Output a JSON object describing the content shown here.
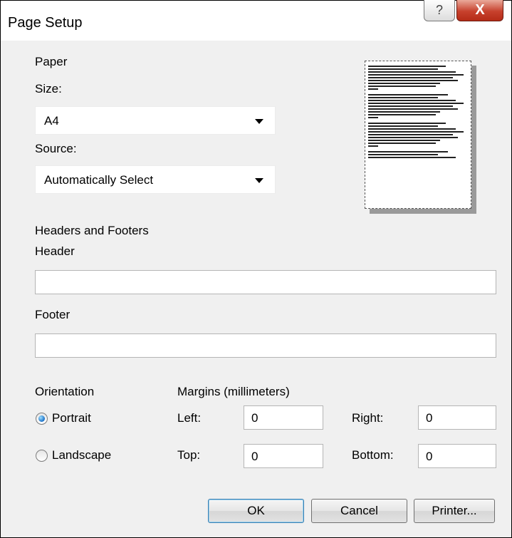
{
  "window": {
    "title": "Page Setup"
  },
  "titlebar": {
    "help_glyph": "?",
    "close_glyph": "X"
  },
  "paper": {
    "heading": "Paper",
    "size_label": "Size:",
    "size_value": "A4",
    "source_label": "Source:",
    "source_value": "Automatically Select"
  },
  "headers_footers": {
    "heading": "Headers and Footers",
    "header_label": "Header",
    "header_value": "",
    "footer_label": "Footer",
    "footer_value": ""
  },
  "orientation": {
    "heading": "Orientation",
    "portrait_label": "Portrait",
    "landscape_label": "Landscape",
    "selected": "Portrait"
  },
  "margins": {
    "heading": "Margins (millimeters)",
    "left_label": "Left:",
    "left_value": "0",
    "right_label": "Right:",
    "right_value": "0",
    "top_label": "Top:",
    "top_value": "0",
    "bottom_label": "Bottom:",
    "bottom_value": "0"
  },
  "buttons": {
    "ok": "OK",
    "cancel": "Cancel",
    "printer": "Printer..."
  },
  "colors": {
    "close_red": "#c7412d",
    "default_button_border": "#3c7fb1",
    "dialog_bg": "#f0f0f0"
  }
}
